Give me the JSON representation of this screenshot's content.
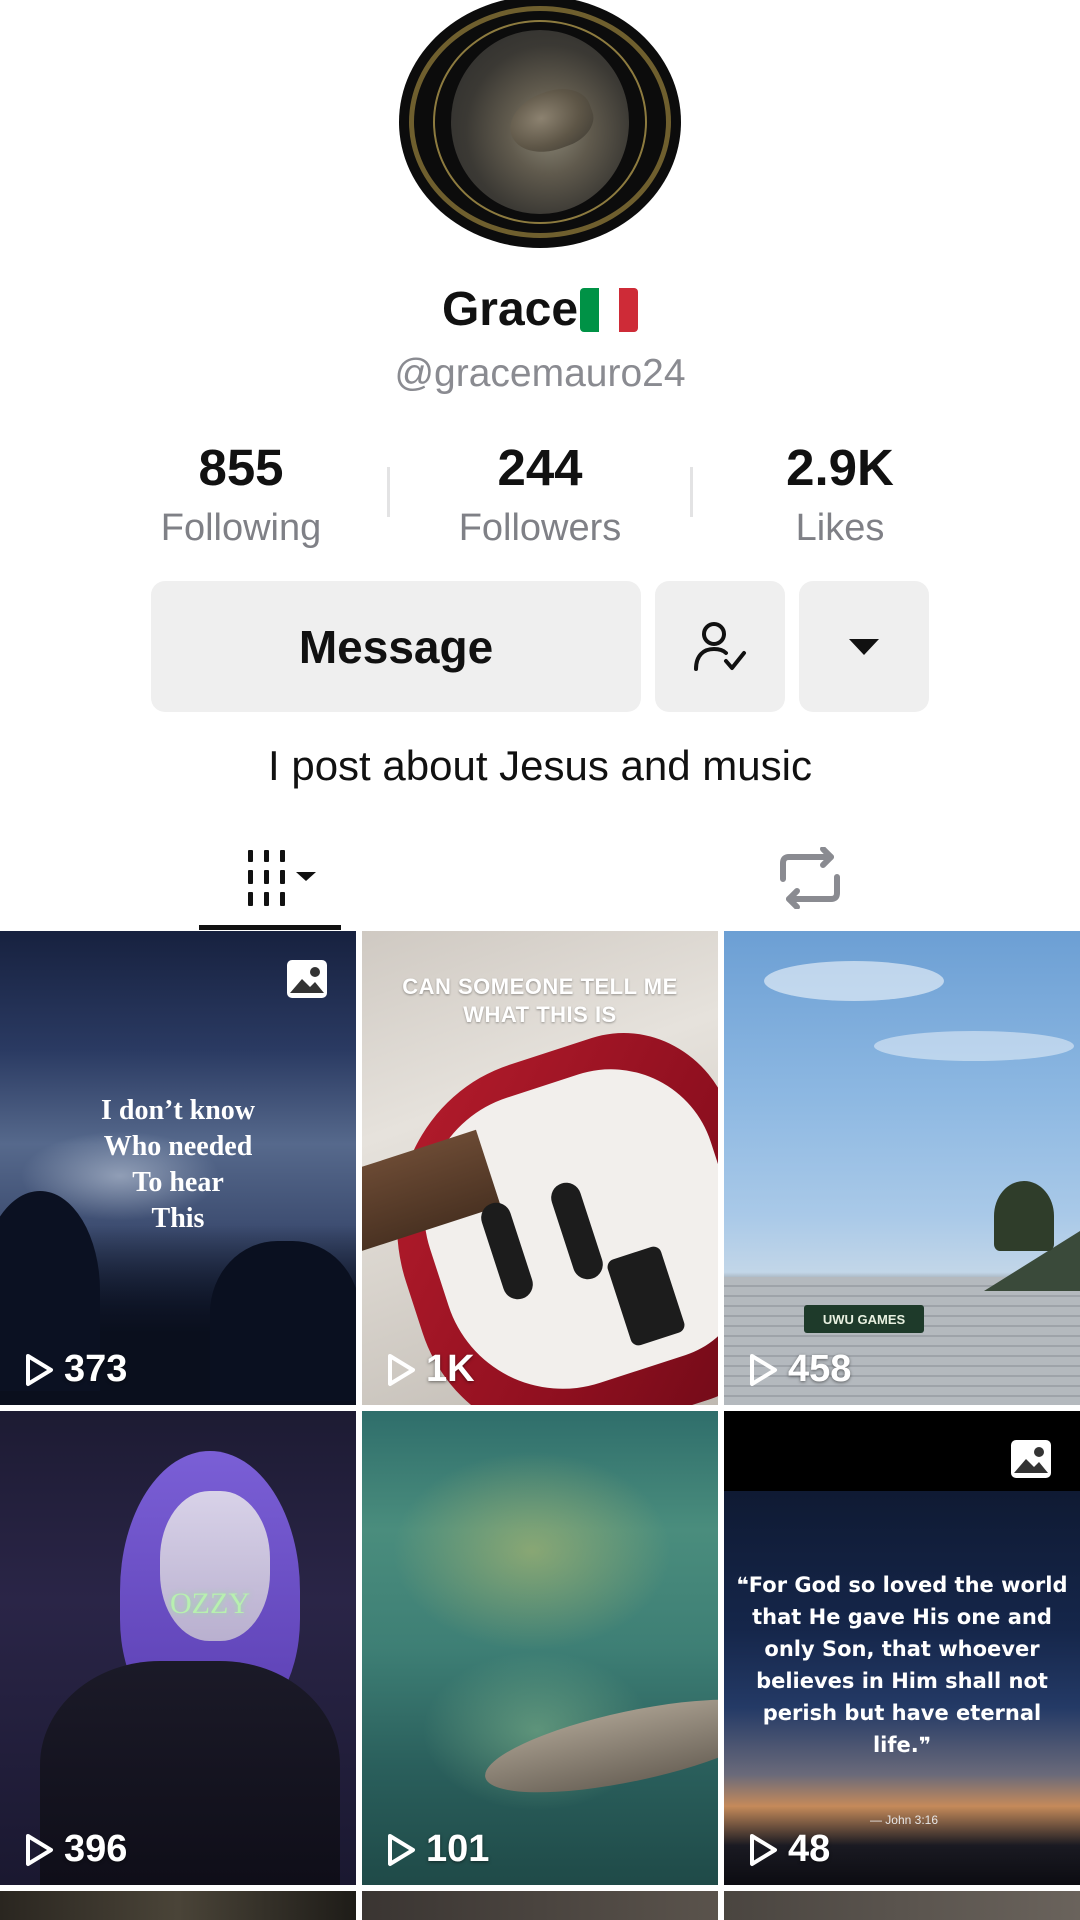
{
  "profile": {
    "name": "Grace",
    "flag_colors": [
      "#009246",
      "#ffffff",
      "#ce2b37"
    ],
    "handle": "@gracemauro24",
    "bio": "I post about Jesus and music"
  },
  "stats": [
    {
      "value": "855",
      "label": "Following"
    },
    {
      "value": "244",
      "label": "Followers"
    },
    {
      "value": "2.9K",
      "label": "Likes"
    }
  ],
  "actions": {
    "message_label": "Message",
    "follow_icon": "person-check-icon",
    "more_icon": "caret-down-icon"
  },
  "tabs": [
    {
      "icon": "videos-grid-icon",
      "active": true
    },
    {
      "icon": "repost-icon",
      "active": false
    }
  ],
  "videos": [
    {
      "views": "373",
      "caption": "I don’t know\nWho needed\nTo hear\nThis",
      "photo_post": true
    },
    {
      "views": "1K",
      "caption": "CAN SOMEONE TELL ME\nWHAT THIS IS",
      "photo_post": false
    },
    {
      "views": "458",
      "caption": "UWU GAMES",
      "photo_post": false
    },
    {
      "views": "396",
      "caption": "OZZY",
      "photo_post": false
    },
    {
      "views": "101",
      "caption": "",
      "photo_post": false
    },
    {
      "views": "48",
      "caption": "❝For God so loved the world that He gave His one and only Son, that whoever believes in Him shall not perish but have eternal life.❞",
      "caption_ref": "— John 3:16",
      "photo_post": true
    }
  ]
}
